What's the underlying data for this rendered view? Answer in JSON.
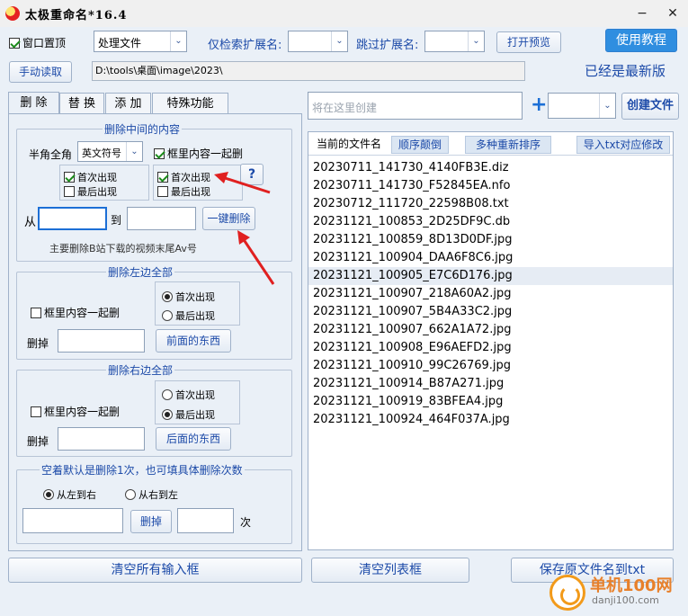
{
  "window": {
    "title": "太极重命名*16.4",
    "minimize": "−",
    "close": "✕"
  },
  "toolbar": {
    "topmost_label": "窗口置顶",
    "topmost_checked": true,
    "mode_value": "处理文件",
    "only_ext_label": "仅检索扩展名:",
    "only_ext_value": "",
    "skip_ext_label": "跳过扩展名:",
    "skip_ext_value": "",
    "preview_button": "打开预览",
    "tutorial_button": "使用教程",
    "manual_read_button": "手动读取",
    "path": "D:\\tools\\桌面\\image\\2023\\",
    "version_status": "已经是最新版"
  },
  "tabs": [
    "删 除",
    "替 换",
    "添 加",
    "特殊功能"
  ],
  "delete_middle": {
    "title": "删除中间的内容",
    "width_label": "半角全角",
    "width_value": "英文符号",
    "frame_delete_label": "框里内容一起删",
    "first_label_a": "首次出现",
    "last_label_a": "最后出现",
    "first_label_b": "首次出现",
    "last_label_b": "最后出现",
    "help": "?",
    "from_label": "从",
    "to_label": "到",
    "from_value": "",
    "to_value": "",
    "one_click_button": "一键删除",
    "hint": "主要删除B站下载的视频末尾Av号"
  },
  "delete_left": {
    "title": "删除左边全部",
    "frame_delete_label": "框里内容一起删",
    "first_label": "首次出现",
    "last_label": "最后出现",
    "remove_label": "删掉",
    "remove_value": "",
    "front_button": "前面的东西"
  },
  "delete_right": {
    "title": "删除右边全部",
    "frame_delete_label": "框里内容一起删",
    "first_label": "首次出现",
    "last_label": "最后出现",
    "remove_label": "删掉",
    "remove_value": "",
    "back_button": "后面的东西"
  },
  "delete_count": {
    "title": "空着默认是删除1次，也可填具体删除次数",
    "ltr_label": "从左到右",
    "rtl_label": "从右到左",
    "text_value": "",
    "remove_button": "删掉",
    "count_value": "",
    "times_label": "次"
  },
  "create": {
    "placeholder": "将在这里创建",
    "plus": "+",
    "type_value": "",
    "create_button": "创建文件"
  },
  "list": {
    "headers": [
      "当前的文件名",
      "顺序颠倒",
      "多种重新排序",
      "导入txt对应修改"
    ],
    "files": [
      "20230711_141730_4140FB3E.diz",
      "20230711_141730_F52845EA.nfo",
      "20230712_111720_22598B08.txt",
      "20231121_100853_2D25DF9C.db",
      "20231121_100859_8D13D0DF.jpg",
      "20231121_100904_DAA6F8C6.jpg",
      "20231121_100905_E7C6D176.jpg",
      "20231121_100907_218A60A2.jpg",
      "20231121_100907_5B4A33C2.jpg",
      "20231121_100907_662A1A72.jpg",
      "20231121_100908_E96AEFD2.jpg",
      "20231121_100910_99C26769.jpg",
      "20231121_100914_B87A271.jpg",
      "20231121_100919_83BFEA4.jpg",
      "20231121_100924_464F037A.jpg"
    ],
    "selected_index": 6
  },
  "bottom": {
    "clear_inputs": "清空所有输入框",
    "clear_list": "清空列表框",
    "save_names": "保存原文件名到txt"
  },
  "watermark": {
    "name": "单机100网",
    "domain": "danji100.com"
  },
  "colors": {
    "accent": "#2f8ee0",
    "link_text": "#1c4aa8",
    "annotation_arrow": "#e02020"
  }
}
